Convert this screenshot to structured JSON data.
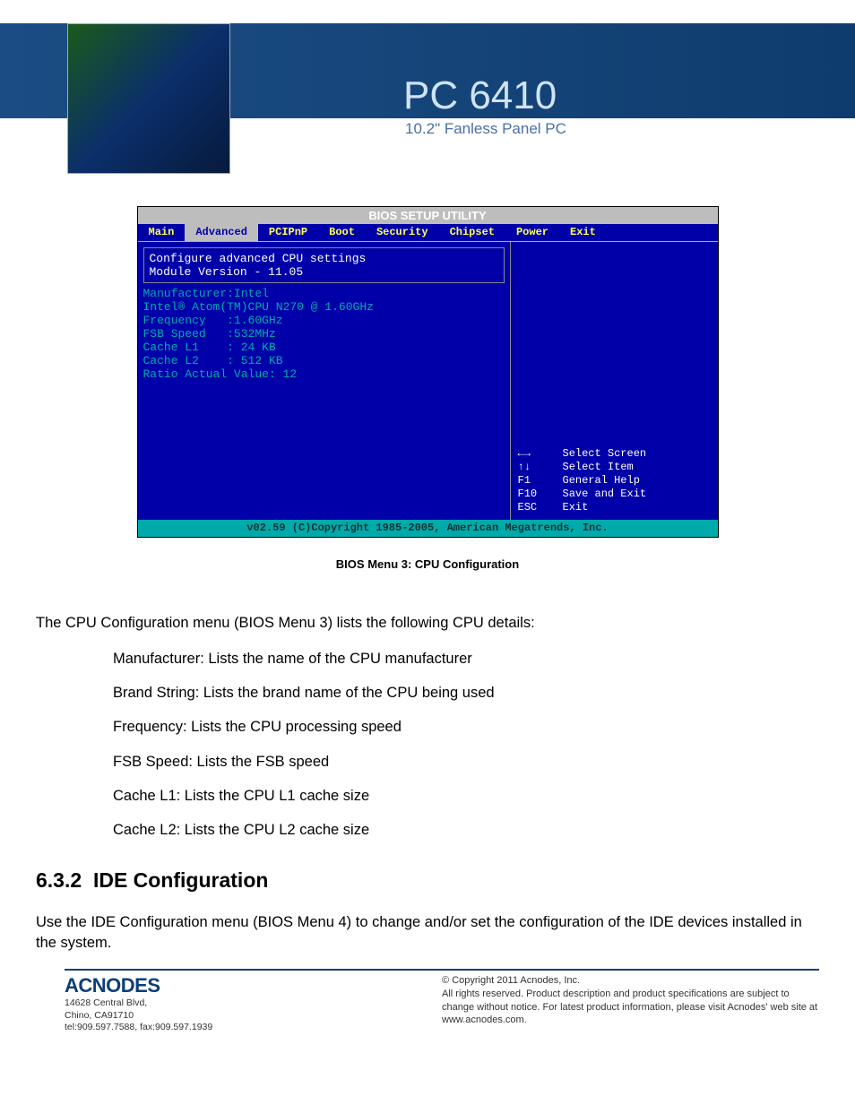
{
  "header": {
    "title": "PC 6410",
    "subtitle": "10.2\" Fanless Panel PC"
  },
  "bios": {
    "top": "BIOS SETUP UTILITY",
    "tabs": [
      "Main",
      "Advanced",
      "PCIPnP",
      "Boot",
      "Security",
      "Chipset",
      "Power",
      "Exit"
    ],
    "active_tab": "Advanced",
    "block1": [
      "Configure advanced CPU settings",
      "Module Version - 11.05"
    ],
    "lines": [
      "Manufacturer:Intel",
      "Intel® Atom(TM)CPU N270 @ 1.60GHz",
      "Frequency   :1.60GHz",
      "FSB Speed   :532MHz",
      "",
      "Cache L1    : 24 KB",
      "Cache L2    : 512 KB",
      "",
      "Ratio Actual Value: 12"
    ],
    "help": [
      {
        "key": "←→",
        "txt": "Select Screen"
      },
      {
        "key": "↑↓",
        "txt": "Select Item"
      },
      {
        "key": "F1",
        "txt": "General Help"
      },
      {
        "key": "F10",
        "txt": "Save and Exit"
      },
      {
        "key": "ESC",
        "txt": "Exit"
      }
    ],
    "footer": "v02.59 (C)Copyright 1985-2005, American Megatrends, Inc.",
    "caption": "BIOS Menu 3: CPU Configuration"
  },
  "body": {
    "intro": "The CPU Configuration menu (BIOS Menu 3) lists the following CPU details:",
    "items": [
      "Manufacturer: Lists the name of the CPU manufacturer",
      "Brand String: Lists the brand name of the CPU being used",
      "Frequency: Lists the CPU processing speed",
      "FSB Speed: Lists the FSB speed",
      "Cache L1: Lists the CPU L1 cache size",
      "Cache L2: Lists the CPU L2 cache size"
    ],
    "section_no": "6.3.2",
    "section_title": "IDE Configuration",
    "section_body": "Use the IDE Configuration menu (BIOS Menu 4) to change and/or set the configuration of the IDE devices installed in the system."
  },
  "footer": {
    "logo": "ACNODES",
    "addr1": "14628 Central Blvd,",
    "addr2": "Chino, CA91710",
    "addr3": "tel:909.597.7588, fax:909.597.1939",
    "copy1": "© Copyright 2011 Acnodes, Inc.",
    "copy2": "All rights reserved. Product description and product specifications are subject to change without notice. For latest product information, please visit Acnodes' web site at www.acnodes.com."
  }
}
